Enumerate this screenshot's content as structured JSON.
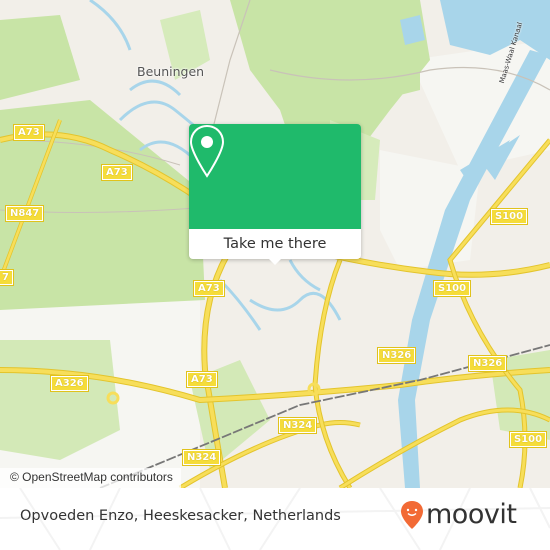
{
  "map": {
    "place_labels": [
      {
        "id": "beuningen",
        "text": "Beuningen"
      }
    ],
    "canal_label": "Maas-Waal Kanaal",
    "road_labels": [
      {
        "id": "a73-1",
        "text": "A73"
      },
      {
        "id": "a73-2",
        "text": "A73"
      },
      {
        "id": "a73-3",
        "text": "A73"
      },
      {
        "id": "a73-4",
        "text": "A73"
      },
      {
        "id": "n847",
        "text": "N847"
      },
      {
        "id": "n847-edge",
        "text": "7"
      },
      {
        "id": "a326",
        "text": "A326"
      },
      {
        "id": "n324-1",
        "text": "N324"
      },
      {
        "id": "n324-2",
        "text": "N324"
      },
      {
        "id": "n326-1",
        "text": "N326"
      },
      {
        "id": "n326-2",
        "text": "N326"
      },
      {
        "id": "s100-1",
        "text": "S100"
      },
      {
        "id": "s100-2",
        "text": "S100"
      },
      {
        "id": "s100-3",
        "text": "S100"
      }
    ],
    "attribution": "© OpenStreetMap contributors",
    "colors": {
      "land": "#f2efe9",
      "green": "#c8e4a6",
      "water": "#a8d5ea",
      "road": "#f7de5a",
      "rail": "#777777"
    }
  },
  "popup": {
    "icon": "map-pin-icon",
    "action_label": "Take me there",
    "accent_color": "#1fba6b"
  },
  "footer": {
    "place_name": "Opvoeden Enzo, Heeskesacker, Netherlands",
    "brand": {
      "name": "moovit",
      "icon": "moovit-pin-icon",
      "color": "#f26a35"
    }
  }
}
